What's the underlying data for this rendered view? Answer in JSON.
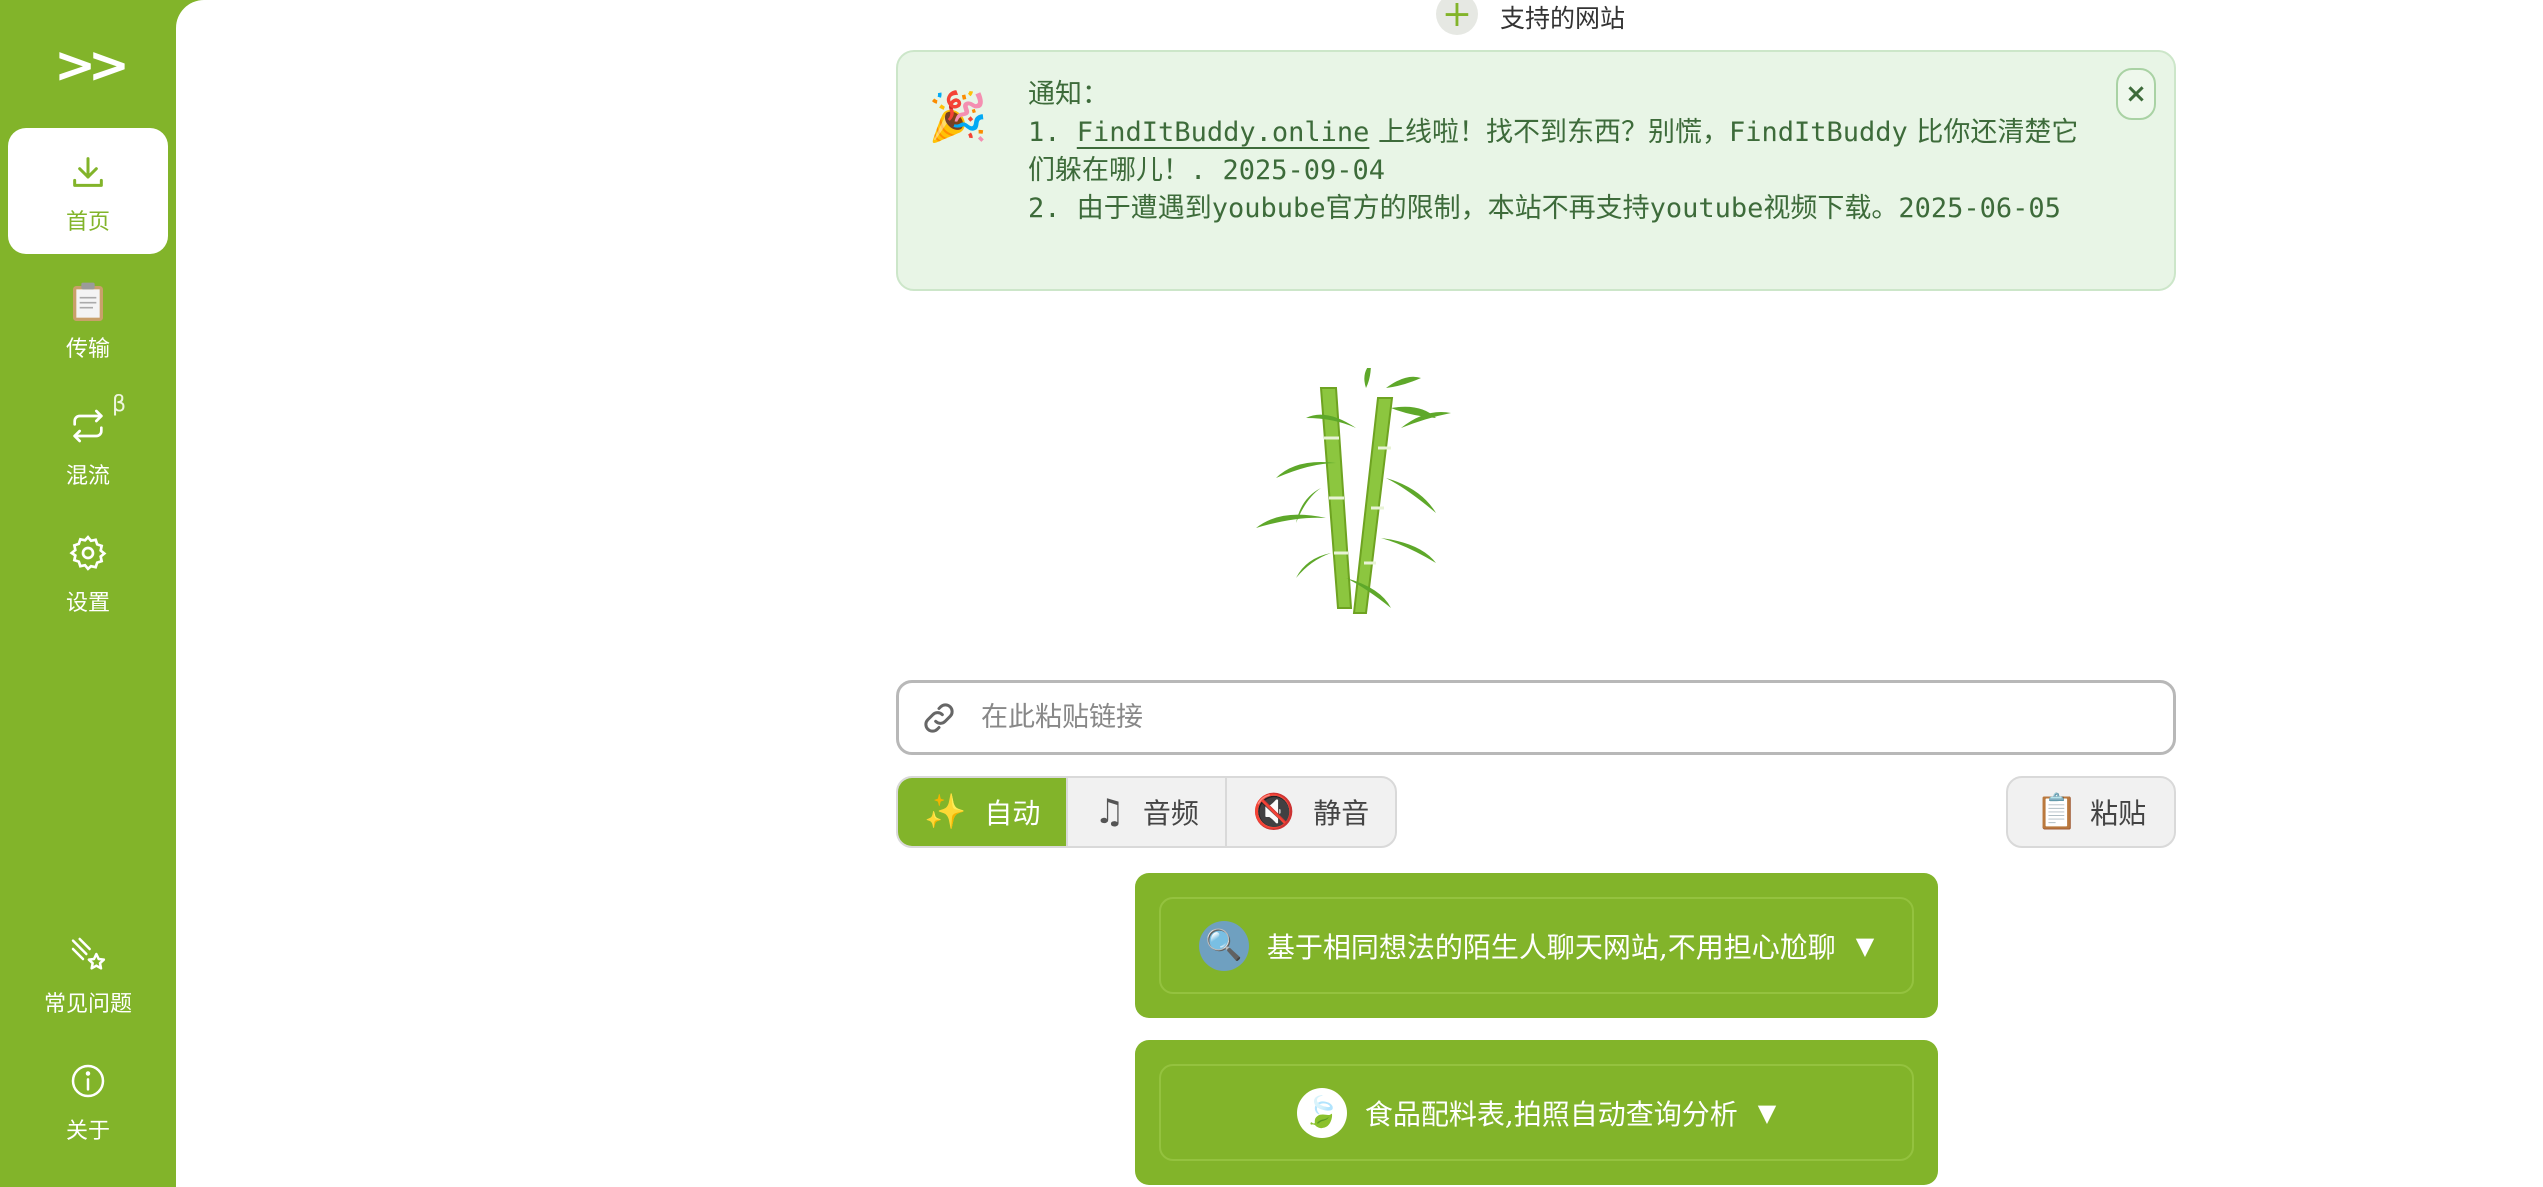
{
  "sidebar": {
    "toggle": ">>",
    "items": [
      {
        "label": "首页",
        "icon": "download-icon",
        "active": true
      },
      {
        "label": "传输",
        "icon": "clipboard-icon",
        "active": false
      },
      {
        "label": "混流",
        "icon": "repeat-icon",
        "active": false,
        "badge": "β"
      },
      {
        "label": "设置",
        "icon": "gear-icon",
        "active": false
      }
    ],
    "bottom_items": [
      {
        "label": "常见问题",
        "icon": "sparkles-icon"
      },
      {
        "label": "关于",
        "icon": "info-icon"
      }
    ],
    "accent_color": "#82b42a"
  },
  "header": {
    "supported_sites": "支持的网站"
  },
  "notice": {
    "title": "通知：",
    "line1_prefix": "1. ",
    "line1_link": "FindItBuddy.online",
    "line1_cjk1": " 上线啦！找不到东西？别慌，",
    "line1_brand": "FindItBuddy",
    "line1_cjk2": " 比你还清楚它们躲在哪儿！",
    "line1_date": ". 2025-09-04",
    "line2_prefix": "2. ",
    "line2_cjk1": "由于遭遇到",
    "line2_w1": "youbube",
    "line2_cjk2": "官方的限制，本站不再支持",
    "line2_w2": "youtube",
    "line2_cjk3": "视频下载。",
    "line2_date": "2025-06-05",
    "close": "×"
  },
  "search": {
    "placeholder": "在此粘贴链接",
    "value": ""
  },
  "modes": [
    {
      "label": "自动",
      "icon": "✨",
      "active": true
    },
    {
      "label": "音频",
      "icon": "♫",
      "active": false
    },
    {
      "label": "静音",
      "icon": "🔇",
      "active": false
    }
  ],
  "paste": {
    "label": "粘贴",
    "icon": "📋"
  },
  "promos": [
    {
      "label": "基于相同想法的陌生人聊天网站,不用担心尬聊",
      "icon": "🔍",
      "arrow": "▼"
    },
    {
      "label": "食品配料表,拍照自动查询分析",
      "icon": "🍃",
      "arrow": "▼"
    }
  ]
}
